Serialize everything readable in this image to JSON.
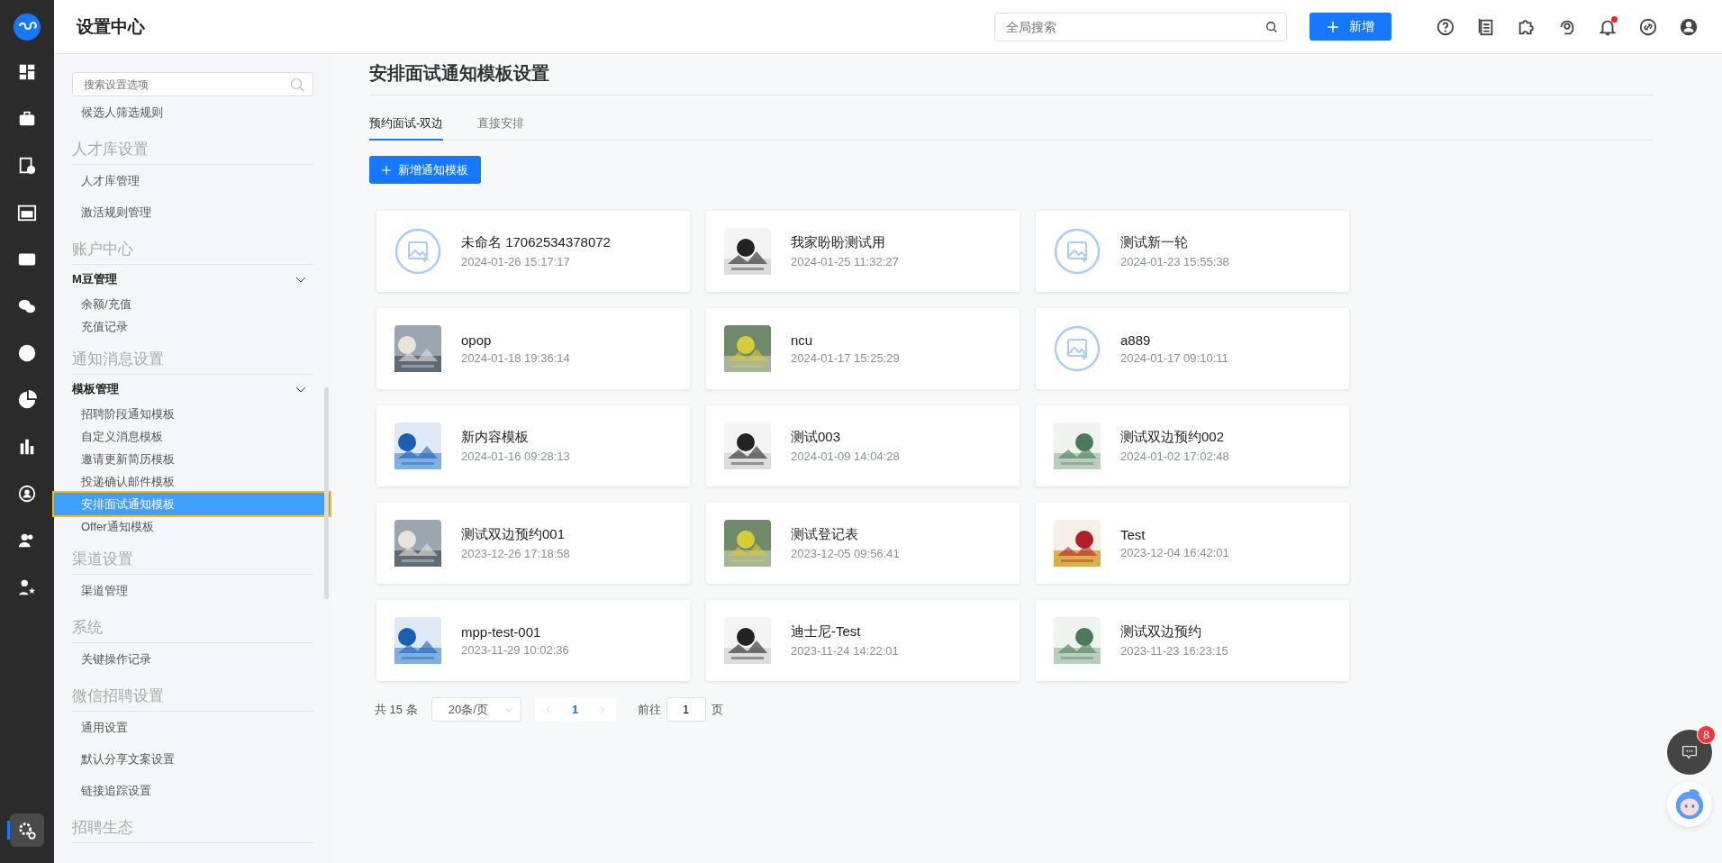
{
  "rail": {
    "items": [
      {
        "selected": false
      },
      {
        "selected": false
      },
      {
        "selected": false
      },
      {
        "selected": false
      },
      {
        "selected": false
      },
      {
        "selected": false
      },
      {
        "selected": false
      },
      {
        "selected": false
      },
      {
        "selected": false
      },
      {
        "selected": false
      },
      {
        "selected": false
      },
      {
        "selected": false
      },
      {
        "selected": true
      }
    ]
  },
  "header": {
    "title": "设置中心",
    "search": {
      "placeholder": "全局搜索"
    },
    "new_button": "新增",
    "tools": [
      {
        "unread": false
      },
      {
        "unread": false
      },
      {
        "unread": false
      },
      {
        "unread": false
      },
      {
        "unread": true
      },
      {
        "unread": false
      },
      {
        "unread": false
      }
    ]
  },
  "sidebar": {
    "search": {
      "placeholder": "搜索设置选项"
    },
    "top_items": [
      {
        "label": "候选人筛选规则",
        "selected": false
      }
    ],
    "sections": [
      {
        "heading": "人才库设置",
        "entries": [
          {
            "kind": "link",
            "label": "人才库管理",
            "selected": false
          },
          {
            "kind": "link",
            "label": "激活规则管理",
            "selected": false
          }
        ]
      },
      {
        "heading": "账户中心",
        "entries": [
          {
            "kind": "group",
            "label": "M豆管理",
            "expanded": true,
            "children": [
              {
                "label": "余额/充值",
                "selected": false
              },
              {
                "label": "充值记录",
                "selected": false
              }
            ]
          }
        ]
      },
      {
        "heading": "通知消息设置",
        "entries": [
          {
            "kind": "group",
            "label": "模板管理",
            "expanded": true,
            "children": [
              {
                "label": "招聘阶段通知模板",
                "selected": false
              },
              {
                "label": "自定义消息模板",
                "selected": false
              },
              {
                "label": "邀请更新简历模板",
                "selected": false
              },
              {
                "label": "投递确认邮件模板",
                "selected": false
              },
              {
                "label": "安排面试通知模板",
                "selected": true
              },
              {
                "label": "Offer通知模板",
                "selected": false
              }
            ]
          }
        ]
      },
      {
        "heading": "渠道设置",
        "entries": [
          {
            "kind": "link",
            "label": "渠道管理",
            "selected": false
          }
        ]
      },
      {
        "heading": "系统",
        "entries": [
          {
            "kind": "link",
            "label": "关键操作记录",
            "selected": false
          }
        ]
      },
      {
        "heading": "微信招聘设置",
        "entries": [
          {
            "kind": "link",
            "label": "通用设置",
            "selected": false
          },
          {
            "kind": "link",
            "label": "默认分享文案设置",
            "selected": false
          },
          {
            "kind": "link",
            "label": "链接追踪设置",
            "selected": false
          }
        ]
      },
      {
        "heading": "招聘生态"
      }
    ]
  },
  "main": {
    "title": "安排面试通知模板设置",
    "tabs": [
      {
        "label": "预约面试-双边",
        "selected": true
      },
      {
        "label": "直接安排",
        "selected": false
      }
    ],
    "add_button": "新增通知模板",
    "cards": [
      {
        "title": "未命名 17062534378072",
        "date": "2024-01-26 15:17:17",
        "kind": "placeholder"
      },
      {
        "title": "我家盼盼测试用",
        "date": "2024-01-25 11:32:27",
        "kind": "picture"
      },
      {
        "title": "测试新一轮",
        "date": "2024-01-23 15:55:38",
        "kind": "placeholder"
      },
      {
        "title": "opop",
        "date": "2024-01-18 19:36:14",
        "kind": "picture"
      },
      {
        "title": "ncu",
        "date": "2024-01-17 15:25:29",
        "kind": "picture"
      },
      {
        "title": "a889",
        "date": "2024-01-17 09:10:11",
        "kind": "placeholder"
      },
      {
        "title": "新内容模板",
        "date": "2024-01-16 09:28:13",
        "kind": "picture"
      },
      {
        "title": "测试003",
        "date": "2024-01-09 14:04:28",
        "kind": "picture"
      },
      {
        "title": "测试双边预约002",
        "date": "2024-01-02 17:02:48",
        "kind": "picture"
      },
      {
        "title": "测试双边预约001",
        "date": "2023-12-26 17:18:58",
        "kind": "picture"
      },
      {
        "title": "测试登记表",
        "date": "2023-12-05 09:56:41",
        "kind": "picture"
      },
      {
        "title": "Test",
        "date": "2023-12-04 16:42:01",
        "kind": "picture"
      },
      {
        "title": "mpp-test-001",
        "date": "2023-11-29 10:02:36",
        "kind": "picture"
      },
      {
        "title": "迪士尼-Test",
        "date": "2023-11-24 14:22:01",
        "kind": "picture"
      },
      {
        "title": "测试双边预约",
        "date": "2023-11-23 16:23:15",
        "kind": "picture"
      }
    ],
    "pagination": {
      "total": "共 15 条",
      "page_size": "20条/页",
      "pages": [
        {
          "label": "1",
          "selected": true
        }
      ],
      "goto_label": "前往",
      "goto_value": "1",
      "page_suffix": "页"
    }
  },
  "floating": {
    "chat_badge": "8"
  }
}
